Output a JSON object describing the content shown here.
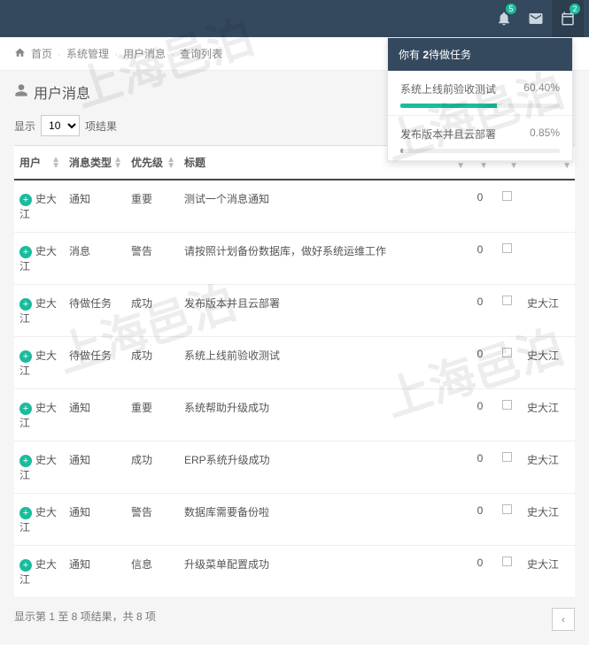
{
  "topbar": {
    "bell_badge": "5",
    "mail_badge": "",
    "cal_badge": "2"
  },
  "breadcrumb": {
    "home": "首页",
    "sys": "系统管理",
    "usermsg": "用户消息",
    "list": "查询列表"
  },
  "title": "用户消息",
  "pagelen": {
    "prefix": "显示",
    "value": "10",
    "suffix": "项结果"
  },
  "headers": {
    "user": "用户",
    "type": "消息类型",
    "priority": "优先级",
    "subject": "标题",
    "num": "",
    "cb": "",
    "from": ""
  },
  "rows": [
    {
      "user": "史大江",
      "type": "通知",
      "priority": "重要",
      "subject": "测试一个消息通知",
      "num": "0",
      "from": ""
    },
    {
      "user": "史大江",
      "type": "消息",
      "priority": "警告",
      "subject": "请按照计划备份数据库，做好系统运维工作",
      "num": "0",
      "from": ""
    },
    {
      "user": "史大江",
      "type": "待做任务",
      "priority": "成功",
      "subject": "发布版本并且云部署",
      "num": "0",
      "from": "史大江"
    },
    {
      "user": "史大江",
      "type": "待做任务",
      "priority": "成功",
      "subject": "系统上线前验收测试",
      "num": "0",
      "from": "史大江"
    },
    {
      "user": "史大江",
      "type": "通知",
      "priority": "重要",
      "subject": "系统帮助升级成功",
      "num": "0",
      "from": "史大江"
    },
    {
      "user": "史大江",
      "type": "通知",
      "priority": "成功",
      "subject": "ERP系统升级成功",
      "num": "0",
      "from": "史大江"
    },
    {
      "user": "史大江",
      "type": "通知",
      "priority": "警告",
      "subject": "数据库需要备份啦",
      "num": "0",
      "from": "史大江"
    },
    {
      "user": "史大江",
      "type": "通知",
      "priority": "信息",
      "subject": "升级菜单配置成功",
      "num": "0",
      "from": "史大江"
    }
  ],
  "footer": "显示第 1 至 8 项结果，共 8 项",
  "popover": {
    "head_prefix": "你有 ",
    "head_count": "2",
    "head_suffix": "待做任务",
    "tasks": [
      {
        "label": "系统上线前验收测试",
        "pct_text": "60.40%",
        "pct": 60.4,
        "color": "green"
      },
      {
        "label": "发布版本并且云部署",
        "pct_text": "0.85%",
        "pct": 0.85,
        "color": "grey"
      }
    ]
  },
  "watermark": "上海邑泊"
}
